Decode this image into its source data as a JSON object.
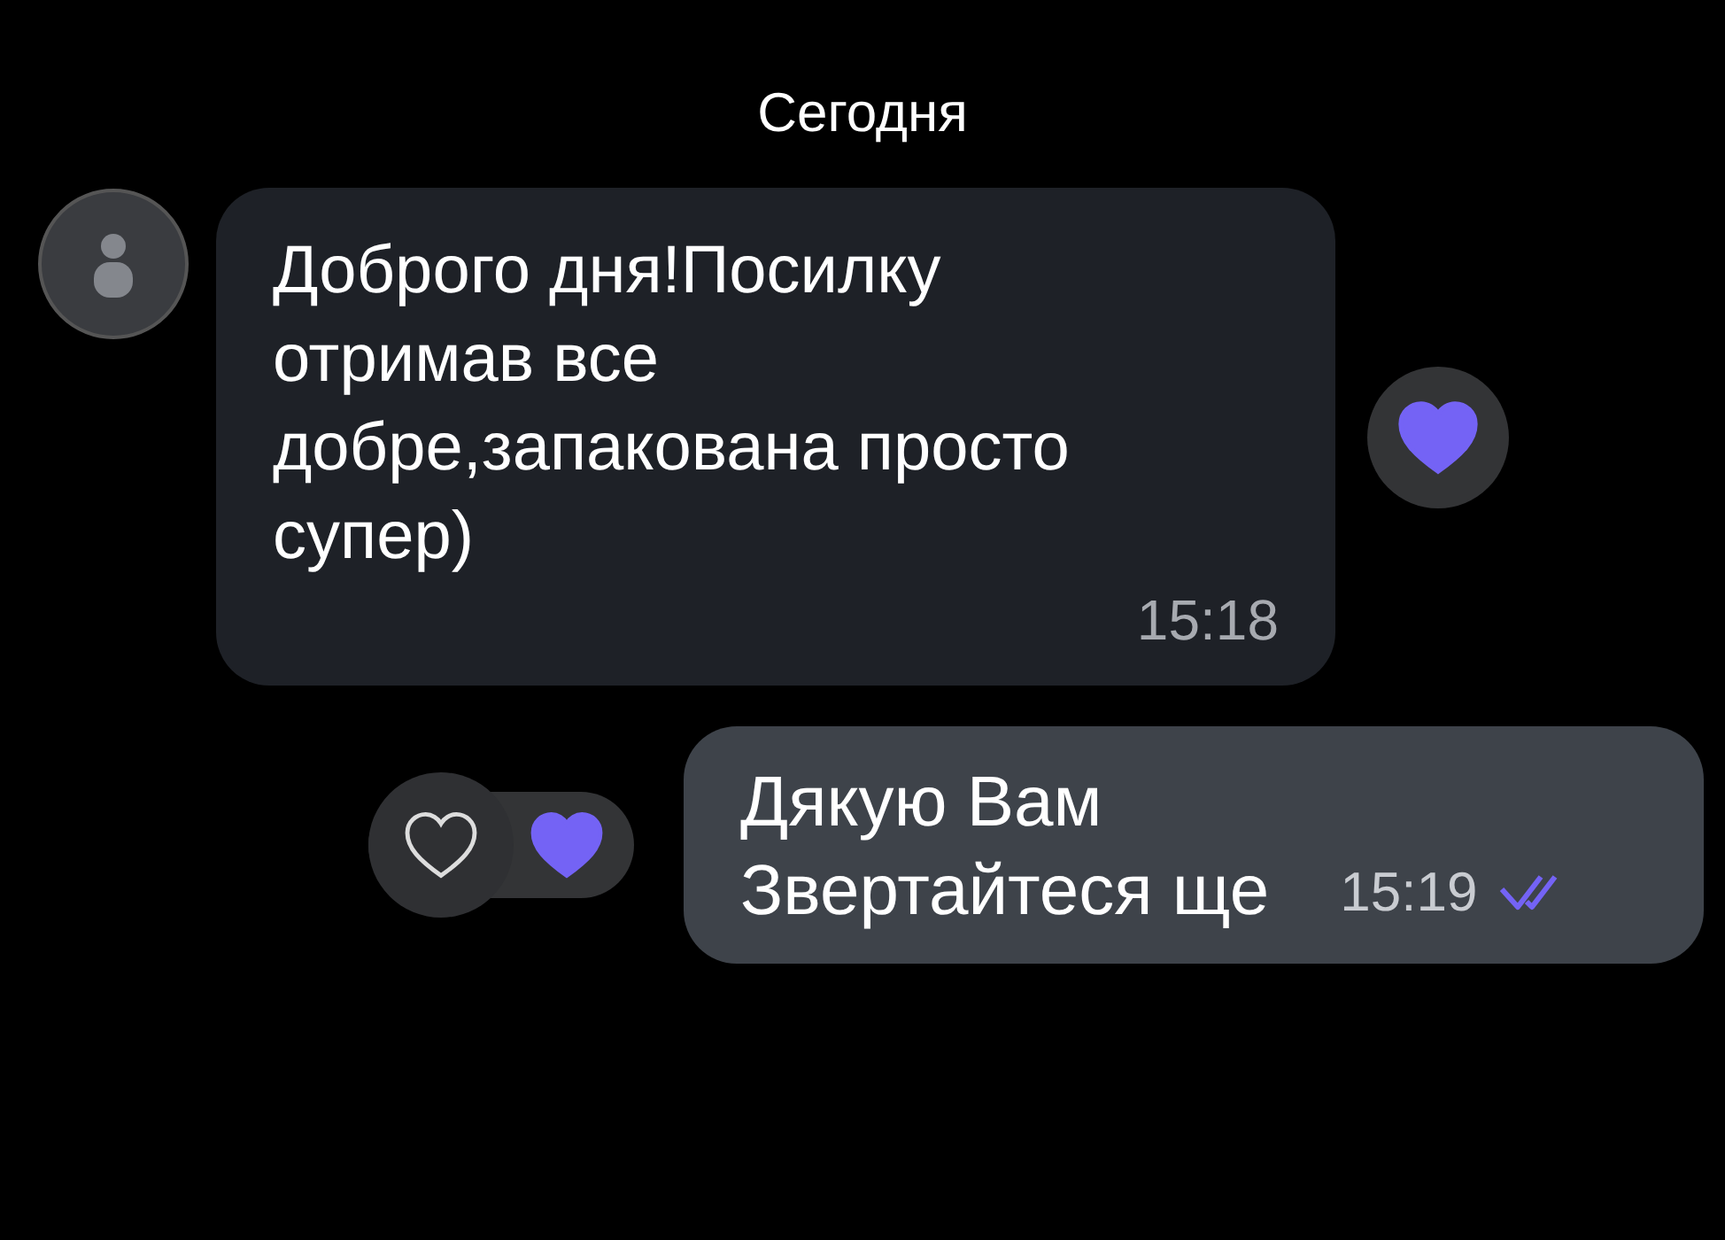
{
  "date_label": "Сегодня",
  "messages": [
    {
      "kind": "incoming",
      "text": "Доброго дня!Посилку отримав все добре,запакована просто супер)",
      "time": "15:18",
      "reactions": [
        {
          "selected": true
        }
      ]
    },
    {
      "kind": "outgoing",
      "text": "Дякую Вам\nЗвертайтеся ще",
      "time": "15:19",
      "read": true,
      "reactions": [
        {
          "selected": false
        },
        {
          "selected": true
        }
      ]
    }
  ]
}
